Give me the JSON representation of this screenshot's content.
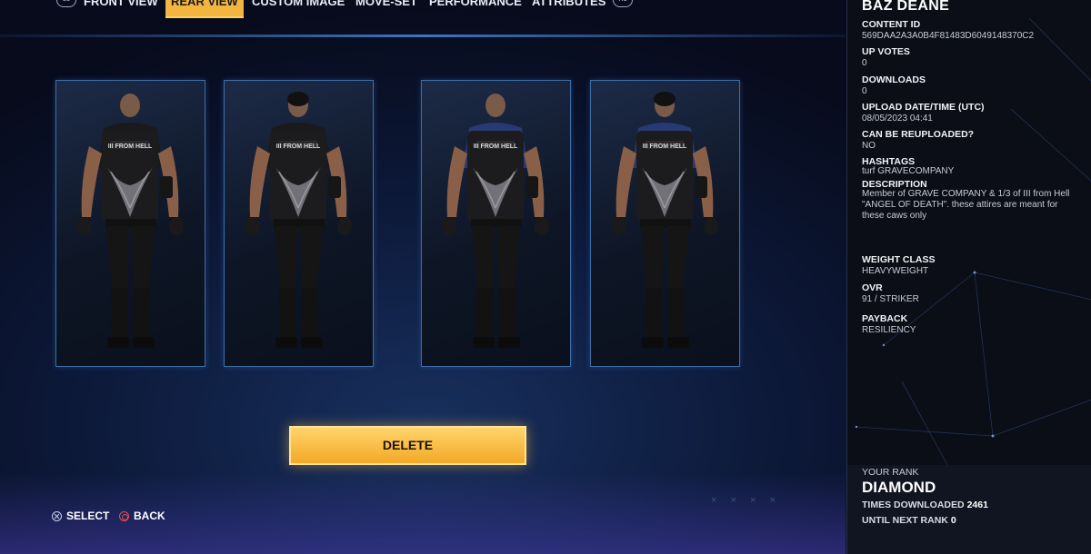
{
  "tabs": {
    "left_bumper": "L1",
    "right_bumper": "R1",
    "items": [
      {
        "label": "FRONT VIEW"
      },
      {
        "label": "REAR VIEW",
        "active": true
      },
      {
        "label": "CUSTOM IMAGE"
      },
      {
        "label": "MOVE-SET"
      },
      {
        "label": "PERFORMANCE"
      },
      {
        "label": "ATTRIBUTES"
      }
    ]
  },
  "cards": [
    {
      "text": "III FROM HELL",
      "sleeve": "#1a1a1a"
    },
    {
      "text": "III FROM HELL",
      "sleeve": "#1a1a1a"
    },
    {
      "text": "III FROM HELL",
      "sleeve": "#283a73"
    },
    {
      "text": "III FROM HELL",
      "sleeve": "#283a73"
    }
  ],
  "actions": {
    "delete_label": "DELETE"
  },
  "hints": {
    "select": "SELECT",
    "back": "BACK"
  },
  "decoration": {
    "x_marks": "× × × ×"
  },
  "details": {
    "name": "BAZ DEANE",
    "fields": [
      {
        "label": "CONTENT ID",
        "value": "569DAA2A3A0B4F81483D6049148370C2"
      },
      {
        "label": "UP VOTES",
        "value": "0"
      },
      {
        "label": "DOWNLOADS",
        "value": "0"
      },
      {
        "label": "UPLOAD DATE/TIME (UTC)",
        "value": "08/05/2023 04:41"
      },
      {
        "label": "CAN BE REUPLOADED?",
        "value": "NO"
      },
      {
        "label": "HASHTAGS",
        "value": "turf GRAVECOMPANY"
      },
      {
        "label": "DESCRIPTION",
        "value": "Member of GRAVE COMPANY & 1/3 of III from Hell  \"ANGEL OF DEATH\". these attires are meant for these  caws only"
      },
      {
        "label": "WEIGHT CLASS",
        "value": "HEAVYWEIGHT"
      },
      {
        "label": "OVR",
        "value": "91 / STRIKER"
      },
      {
        "label": "PAYBACK",
        "value": "RESILIENCY"
      }
    ]
  },
  "rank": {
    "label": "YOUR RANK",
    "name": "DIAMOND",
    "times_downloaded_label": "TIMES DOWNLOADED",
    "times_downloaded": "2461",
    "until_next_label": "UNTIL NEXT RANK",
    "until_next": "0"
  },
  "colors": {
    "accent": "#f2b640",
    "card_border": "#3c6fa8",
    "panel_bg": "#0b0e17"
  }
}
